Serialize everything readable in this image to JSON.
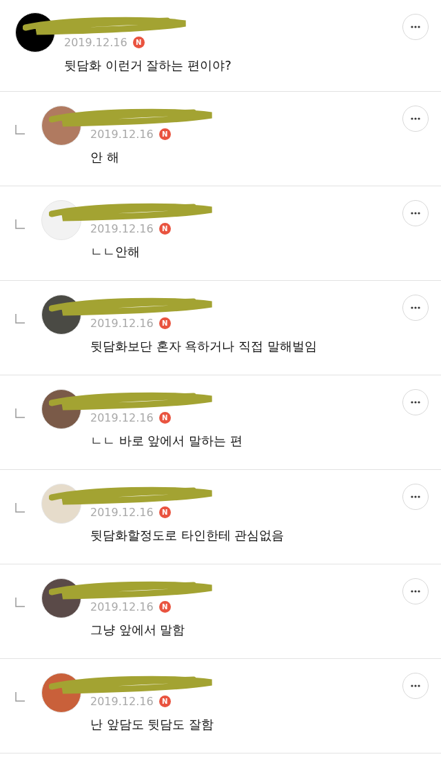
{
  "comments": [
    {
      "kind": "comment",
      "color": "#000000",
      "date": "2019.12.16",
      "new_badge": "N",
      "text": "뒷담화 이런거 잘하는 편이야?"
    },
    {
      "kind": "reply",
      "color": "#b07a60",
      "date": "2019.12.16",
      "new_badge": "N",
      "text": "안 해"
    },
    {
      "kind": "reply",
      "color": "#f2f2f2",
      "date": "2019.12.16",
      "new_badge": "N",
      "text": "ㄴㄴ안해"
    },
    {
      "kind": "reply",
      "color": "#4a4a44",
      "date": "2019.12.16",
      "new_badge": "N",
      "text": "뒷담화보단 혼자 욕하거나 직접 말해벌임"
    },
    {
      "kind": "reply",
      "color": "#7a5a48",
      "date": "2019.12.16",
      "new_badge": "N",
      "text": "ㄴㄴ 바로 앞에서 말하는 편"
    },
    {
      "kind": "reply",
      "color": "#e6dccb",
      "date": "2019.12.16",
      "new_badge": "N",
      "text": "뒷담화할정도로 타인한테 관심없음"
    },
    {
      "kind": "reply",
      "color": "#5a4a48",
      "date": "2019.12.16",
      "new_badge": "N",
      "text": "그냥 앞에서 말함"
    },
    {
      "kind": "reply",
      "color": "#c9603a",
      "date": "2019.12.16",
      "new_badge": "N",
      "text": "난 앞담도 뒷담도 잘함"
    }
  ]
}
